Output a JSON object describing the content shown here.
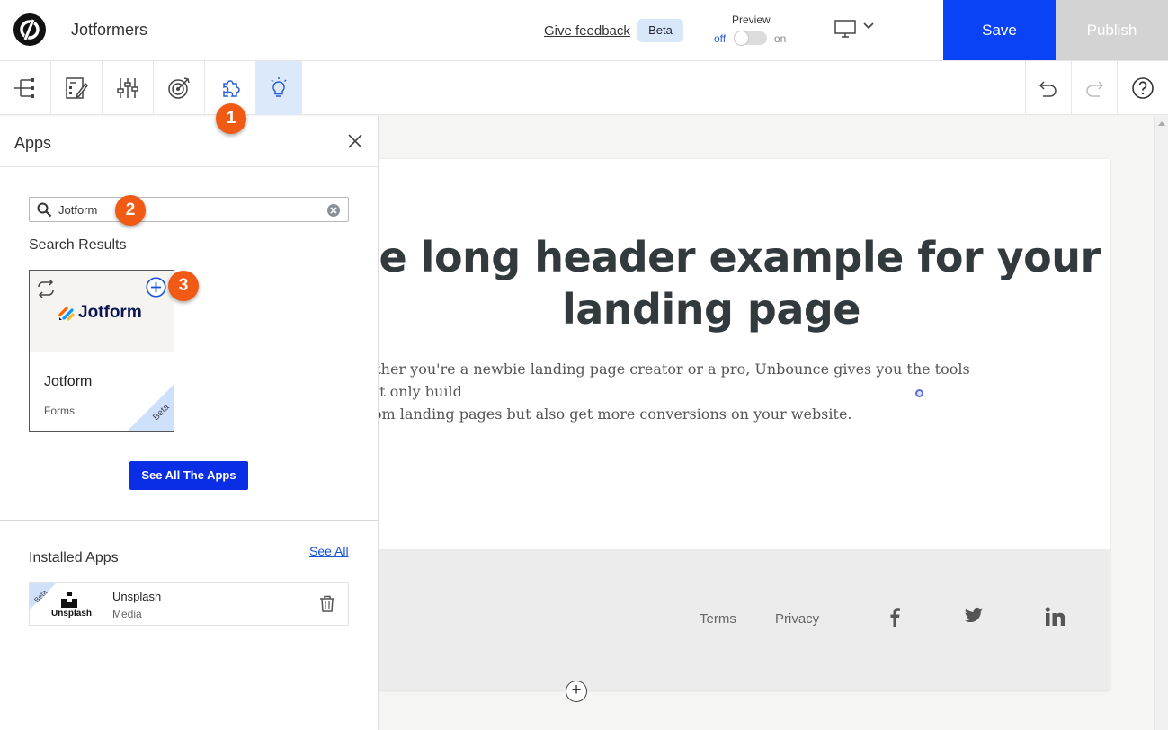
{
  "header": {
    "project_name": "Jotformers",
    "give_feedback": "Give feedback",
    "beta_badge": "Beta",
    "preview_label": "Preview",
    "toggle_off": "off",
    "toggle_on": "on",
    "save_label": "Save",
    "publish_label": "Publish"
  },
  "toolbar": {
    "tools": [
      "page-structure-icon",
      "style-guide-icon",
      "settings-sliders-icon",
      "goals-target-icon",
      "apps-puzzle-icon",
      "smart-tips-bulb-icon"
    ],
    "active_tool": "smart-tips-bulb-icon"
  },
  "steps": {
    "one": "1",
    "two": "2",
    "three": "3"
  },
  "apps_panel": {
    "title": "Apps",
    "search": {
      "value": "Jotform",
      "placeholder": ""
    },
    "results_title": "Search Results",
    "result_card": {
      "logo_text": "Jotform",
      "name": "Jotform",
      "category": "Forms",
      "ribbon": "Beta"
    },
    "see_all_apps": "See All The Apps",
    "installed_title": "Installed Apps",
    "see_all": "See All",
    "installed": {
      "logo_text": "Unsplash",
      "name": "Unsplash",
      "category": "Media",
      "ribbon": "Beta"
    }
  },
  "canvas": {
    "headline": "The long header example for your landing page",
    "subtext": "Whether you're a newbie landing page creator or a pro, Unbounce gives you the tools to not only build\ncustom landing pages but also get more conversions on your website.",
    "footer_links": [
      "Terms",
      "Privacy"
    ],
    "social": [
      "facebook-icon",
      "twitter-icon",
      "linkedin-icon"
    ]
  },
  "colors": {
    "save_blue": "#0a43f5",
    "step_orange": "#f05a14",
    "active_tool_bg": "#dce9fb",
    "publish_disabled": "#d3d3d3"
  }
}
